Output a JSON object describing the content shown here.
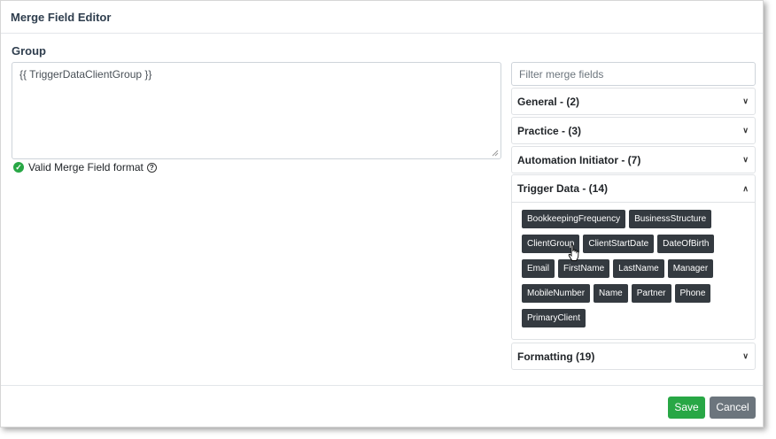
{
  "dialog": {
    "title": "Merge Field Editor"
  },
  "group": {
    "label": "Group"
  },
  "editor": {
    "value": "{{ TriggerDataClientGroup }}"
  },
  "validation": {
    "text": "Valid Merge Field format"
  },
  "filter": {
    "placeholder": "Filter merge fields"
  },
  "accordion": {
    "general": "General - (2)",
    "practice": "Practice - (3)",
    "automation": "Automation Initiator - (7)",
    "trigger": "Trigger Data - (14)",
    "formatting": "Formatting (19)"
  },
  "trigger_fields": [
    "BookkeepingFrequency",
    "BusinessStructure",
    "ClientGroup",
    "ClientStartDate",
    "DateOfBirth",
    "Email",
    "FirstName",
    "LastName",
    "Manager",
    "MobileNumber",
    "Name",
    "Partner",
    "Phone",
    "PrimaryClient"
  ],
  "buttons": {
    "save": "Save",
    "cancel": "Cancel"
  }
}
